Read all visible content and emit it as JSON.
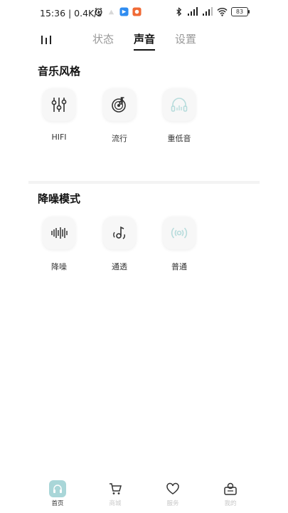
{
  "status_bar": {
    "time": "15:36 | 0.4K/s",
    "battery": "83",
    "colors": {
      "blue_app": "#2f8cf0",
      "orange_app": "#f06a35"
    }
  },
  "tabs": [
    {
      "label": "状态",
      "active": false
    },
    {
      "label": "声音",
      "active": true
    },
    {
      "label": "设置",
      "active": false
    }
  ],
  "music_style": {
    "title": "音乐风格",
    "items": [
      {
        "label": "HIFI",
        "icon": "equalizer-icon"
      },
      {
        "label": "流行",
        "icon": "vinyl-note-icon"
      },
      {
        "label": "重低音",
        "icon": "headphone-bass-icon"
      }
    ]
  },
  "noise_mode": {
    "title": "降噪模式",
    "items": [
      {
        "label": "降噪",
        "icon": "waveform-icon"
      },
      {
        "label": "通透",
        "icon": "ambient-note-icon"
      },
      {
        "label": "普通",
        "icon": "signal-icon"
      }
    ]
  },
  "bottom_nav": [
    {
      "label": "首页",
      "icon": "home-headphone-icon",
      "active": true
    },
    {
      "label": "商城",
      "icon": "cart-icon",
      "active": false
    },
    {
      "label": "服务",
      "icon": "heart-icon",
      "active": false
    },
    {
      "label": "我的",
      "icon": "profile-icon",
      "active": false
    }
  ],
  "accent_color": "#a9d6d8"
}
